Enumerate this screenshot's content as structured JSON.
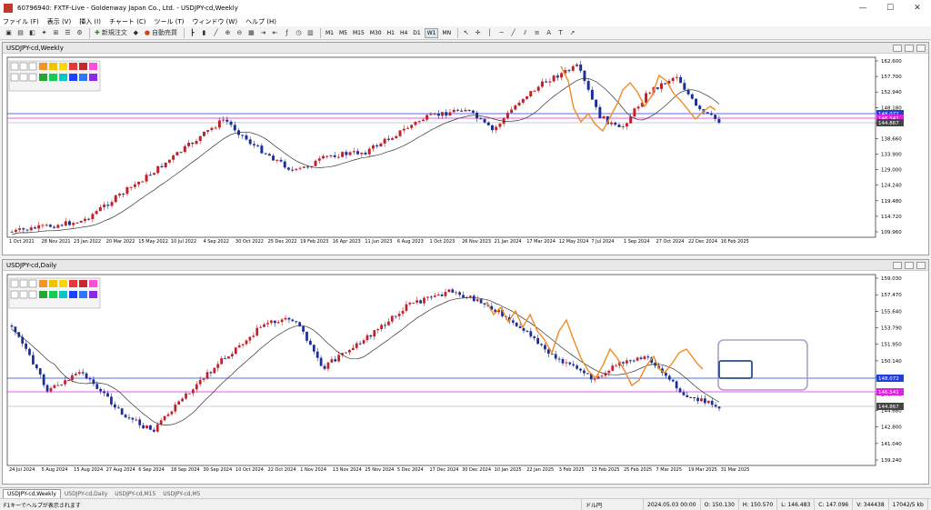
{
  "window": {
    "title": "60796940: FXTF-Live - Goldenway Japan Co., Ltd. - USDJPY-cd,Weekly"
  },
  "menu": [
    "ファイル (F)",
    "表示 (V)",
    "挿入 (I)",
    "チャート (C)",
    "ツール (T)",
    "ウィンドウ (W)",
    "ヘルプ (H)"
  ],
  "toolbar": {
    "new_order": "新規注文",
    "auto_trade": "自動売買",
    "timeframes": [
      "M1",
      "M5",
      "M15",
      "M30",
      "H1",
      "H4",
      "D1",
      "W1",
      "MN"
    ],
    "active_timeframe": "W1"
  },
  "weekly": {
    "title": "USDJPY-cd,Weekly",
    "y_ticks": [
      "162.600",
      "157.700",
      "152.940",
      "148.180",
      "143.420",
      "138.660",
      "133.900",
      "129.000",
      "124.240",
      "119.480",
      "114.720",
      "109.960"
    ],
    "x_ticks": [
      "1 Oct 2021",
      "28 Nov 2021",
      "23 Jan 2022",
      "20 Mar 2022",
      "15 May 2022",
      "10 Jul 2022",
      "4 Sep 2022",
      "30 Oct 2022",
      "25 Dec 2022",
      "19 Feb 2023",
      "16 Apr 2023",
      "11 Jun 2023",
      "6 Aug 2023",
      "1 Oct 2023",
      "26 Nov 2023",
      "21 Jan 2024",
      "17 Mar 2024",
      "12 May 2024",
      "7 Jul 2024",
      "1 Sep 2024",
      "27 Oct 2024",
      "22 Dec 2024",
      "16 Feb 2025"
    ],
    "price_labels": [
      {
        "text": "148.072",
        "color": "#1f3fd8"
      },
      {
        "text": "146.541",
        "color": "#e020e0"
      },
      {
        "text": "144.867",
        "color": "#444444"
      }
    ]
  },
  "daily": {
    "title": "USDJPY-cd,Daily",
    "y_ticks": [
      "159.030",
      "157.470",
      "155.640",
      "153.790",
      "151.950",
      "150.140",
      "148.300",
      "146.470",
      "144.680",
      "142.800",
      "141.040",
      "139.240"
    ],
    "x_ticks": [
      "24 Jul 2024",
      "5 Aug 2024",
      "15 Aug 2024",
      "27 Aug 2024",
      "6 Sep 2024",
      "18 Sep 2024",
      "30 Sep 2024",
      "10 Oct 2024",
      "22 Oct 2024",
      "1 Nov 2024",
      "13 Nov 2024",
      "25 Nov 2024",
      "5 Dec 2024",
      "17 Dec 2024",
      "30 Dec 2024",
      "10 Jan 2025",
      "22 Jan 2025",
      "3 Feb 2025",
      "13 Feb 2025",
      "25 Feb 2025",
      "7 Mar 2025",
      "19 Mar 2025",
      "31 Mar 2025"
    ],
    "price_labels": [
      {
        "text": "148.072",
        "color": "#1f3fd8"
      },
      {
        "text": "146.541",
        "color": "#e020e0"
      },
      {
        "text": "144.867",
        "color": "#444444"
      }
    ]
  },
  "colors": {
    "bull": "#c0202a",
    "bear": "#1a2e9a",
    "ma": "#333333",
    "swing": "#f08a24",
    "blue_line": "#1f3fd8",
    "magenta_line": "#e020e0",
    "box_purple": "#b09cc8",
    "box_blue": "#2a4f8a"
  },
  "tabs": [
    "USDJPY-cd,Weekly",
    "USDJPY-cd,Daily",
    "USDJPY-cd,M15",
    "USDJPY-cd,M5"
  ],
  "active_tab": "USDJPY-cd,Weekly",
  "status": {
    "help": "F1キーでヘルプが表示されます",
    "profile": "ドル円",
    "time": "2024.05.03 00:00",
    "open": "O: 150.130",
    "high": "H: 150.570",
    "low": "L: 146.483",
    "close": "C: 147.096",
    "volume": "V: 344438",
    "traffic": "17042/5 kb"
  }
}
